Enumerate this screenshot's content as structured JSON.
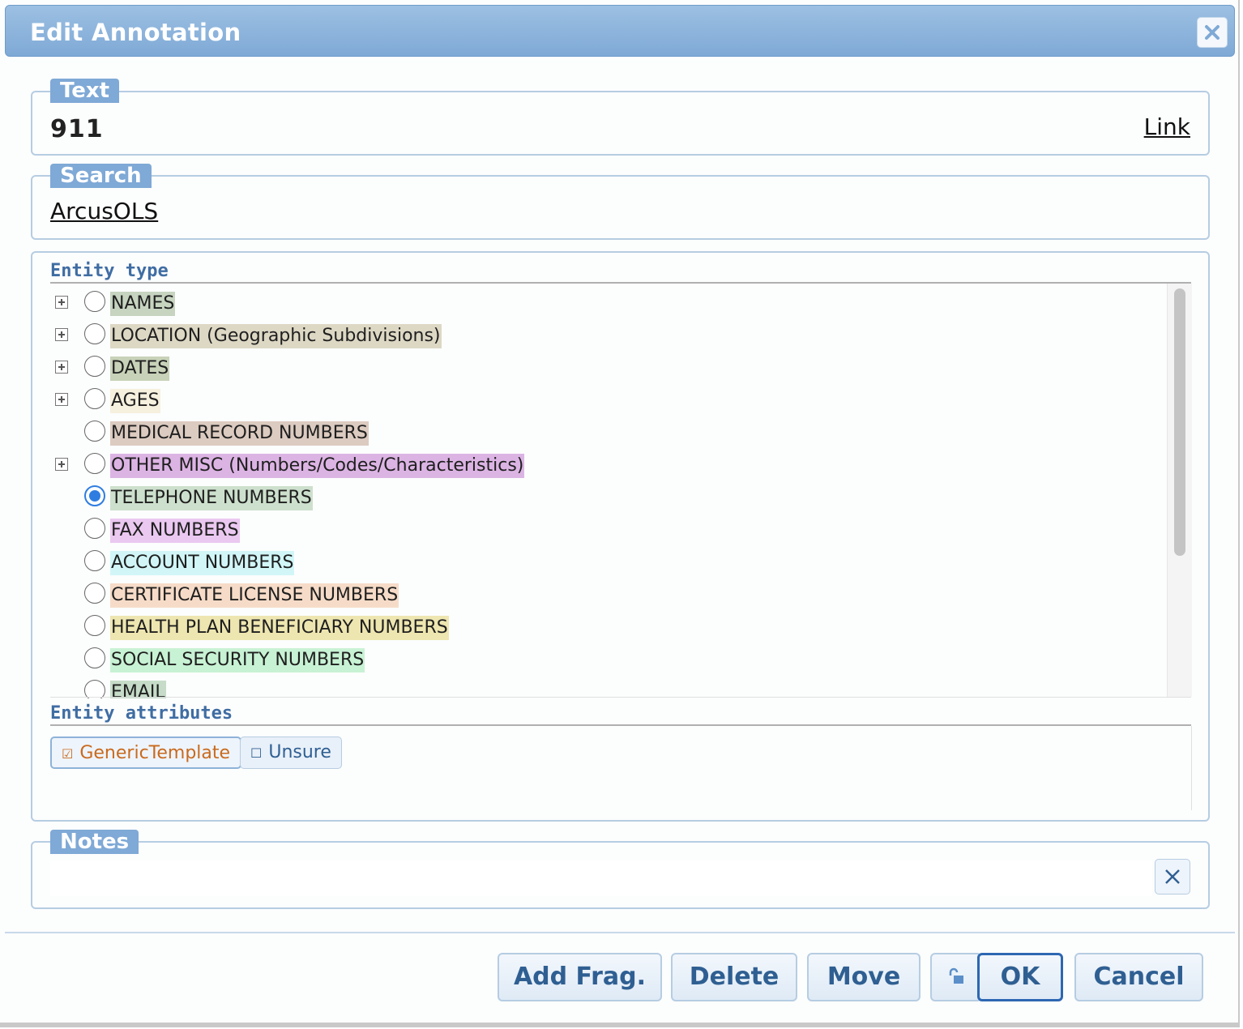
{
  "dialog": {
    "title": "Edit Annotation"
  },
  "text_section": {
    "legend": "Text",
    "value": "911",
    "link_label": "Link"
  },
  "search_section": {
    "legend": "Search",
    "link_label": "ArcusOLS"
  },
  "entity_section": {
    "types_label": "Entity type",
    "types": [
      {
        "label": "NAMES",
        "expandable": true,
        "selected": false,
        "color": "#c6d4c0"
      },
      {
        "label": "LOCATION (Geographic Subdivisions)",
        "expandable": true,
        "selected": false,
        "color": "#ddd8c4"
      },
      {
        "label": "DATES",
        "expandable": true,
        "selected": false,
        "color": "#c7d2b8"
      },
      {
        "label": "AGES",
        "expandable": true,
        "selected": false,
        "color": "#f6f0df"
      },
      {
        "label": "MEDICAL RECORD NUMBERS",
        "expandable": false,
        "selected": false,
        "color": "#dccbc0"
      },
      {
        "label": "OTHER MISC (Numbers/Codes/Characteristics)",
        "expandable": true,
        "selected": false,
        "color": "#dcb4e4"
      },
      {
        "label": "TELEPHONE NUMBERS",
        "expandable": false,
        "selected": true,
        "color": "#cde0cd"
      },
      {
        "label": "FAX NUMBERS",
        "expandable": false,
        "selected": false,
        "color": "#eac8f0"
      },
      {
        "label": "ACCOUNT NUMBERS",
        "expandable": false,
        "selected": false,
        "color": "#d2f6f8"
      },
      {
        "label": "CERTIFICATE LICENSE NUMBERS",
        "expandable": false,
        "selected": false,
        "color": "#f6dcc8"
      },
      {
        "label": "HEALTH PLAN BENEFICIARY NUMBERS",
        "expandable": false,
        "selected": false,
        "color": "#eee6b0"
      },
      {
        "label": "SOCIAL SECURITY NUMBERS",
        "expandable": false,
        "selected": false,
        "color": "#c8f2d4"
      },
      {
        "label": "EMAIL",
        "expandable": false,
        "selected": false,
        "color": "#c6dcc8"
      }
    ],
    "attributes_label": "Entity attributes",
    "attributes": [
      {
        "label": "GenericTemplate",
        "checked": true,
        "check_glyph": "☑"
      },
      {
        "label": "Unsure",
        "checked": false,
        "check_glyph": "☐"
      }
    ]
  },
  "notes_section": {
    "legend": "Notes",
    "value": ""
  },
  "footer": {
    "add_frag_label": "Add Frag.",
    "delete_label": "Delete",
    "move_label": "Move",
    "lock_icon": "lock-icon",
    "ok_label": "OK",
    "cancel_label": "Cancel"
  }
}
